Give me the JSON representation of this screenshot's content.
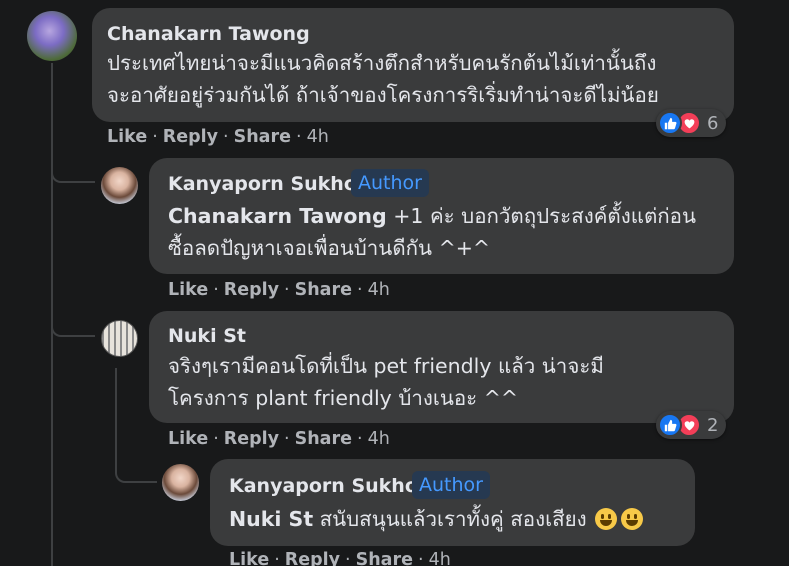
{
  "comments": [
    {
      "author": "Chanakarn Tawong",
      "lines": [
        "ประเทศไทยน่าจะมีแนวคิดสร้างตึกสำหรับคนรักต้นไม้เท่านั้นถึง",
        "จะอาศัยอยู่ร่วมกันได้ ถ้าเจ้าของโครงการริเริ่มทำน่าจะดีไม่น้อย"
      ],
      "actions": {
        "like": "Like",
        "reply": "Reply",
        "share": "Share",
        "time": "4h"
      },
      "reaction_count": "6"
    },
    {
      "author": "Kanyaporn Sukhok",
      "badge": "Author",
      "mention": "Chanakarn Tawong",
      "lines": [
        " +1 ค่ะ บอกวัตถุประสงค์ตั้งแต่ก่อน",
        "ซื้อลดปัญหาเจอเพื่อนบ้านดีกัน ^+^"
      ],
      "actions": {
        "like": "Like",
        "reply": "Reply",
        "share": "Share",
        "time": "4h"
      }
    },
    {
      "author": "Nuki St",
      "lines": [
        "จริงๆเรามีคอนโดที่เป็น pet friendly แล้ว น่าจะมี",
        "โครงการ plant friendly บ้างเนอะ ^^"
      ],
      "actions": {
        "like": "Like",
        "reply": "Reply",
        "share": "Share",
        "time": "4h"
      },
      "reaction_count": "2"
    },
    {
      "author": "Kanyaporn Sukhok",
      "badge": "Author",
      "mention": "Nuki St",
      "lines": [
        " สนับสนุนแล้วเราทั้งคู่ สองเสียง"
      ],
      "actions": {
        "like": "Like",
        "reply": "Reply",
        "share": "Share",
        "time": "4h"
      }
    }
  ],
  "colors": {
    "background": "#18191a",
    "bubble": "#3a3b3c",
    "meta": "#b0b3b8",
    "author_badge": "#4599ff",
    "like": "#1877f2",
    "love": "#f33e58"
  },
  "icons": [
    "like-reaction-icon",
    "love-reaction-icon",
    "grinning-emoji-icon"
  ]
}
